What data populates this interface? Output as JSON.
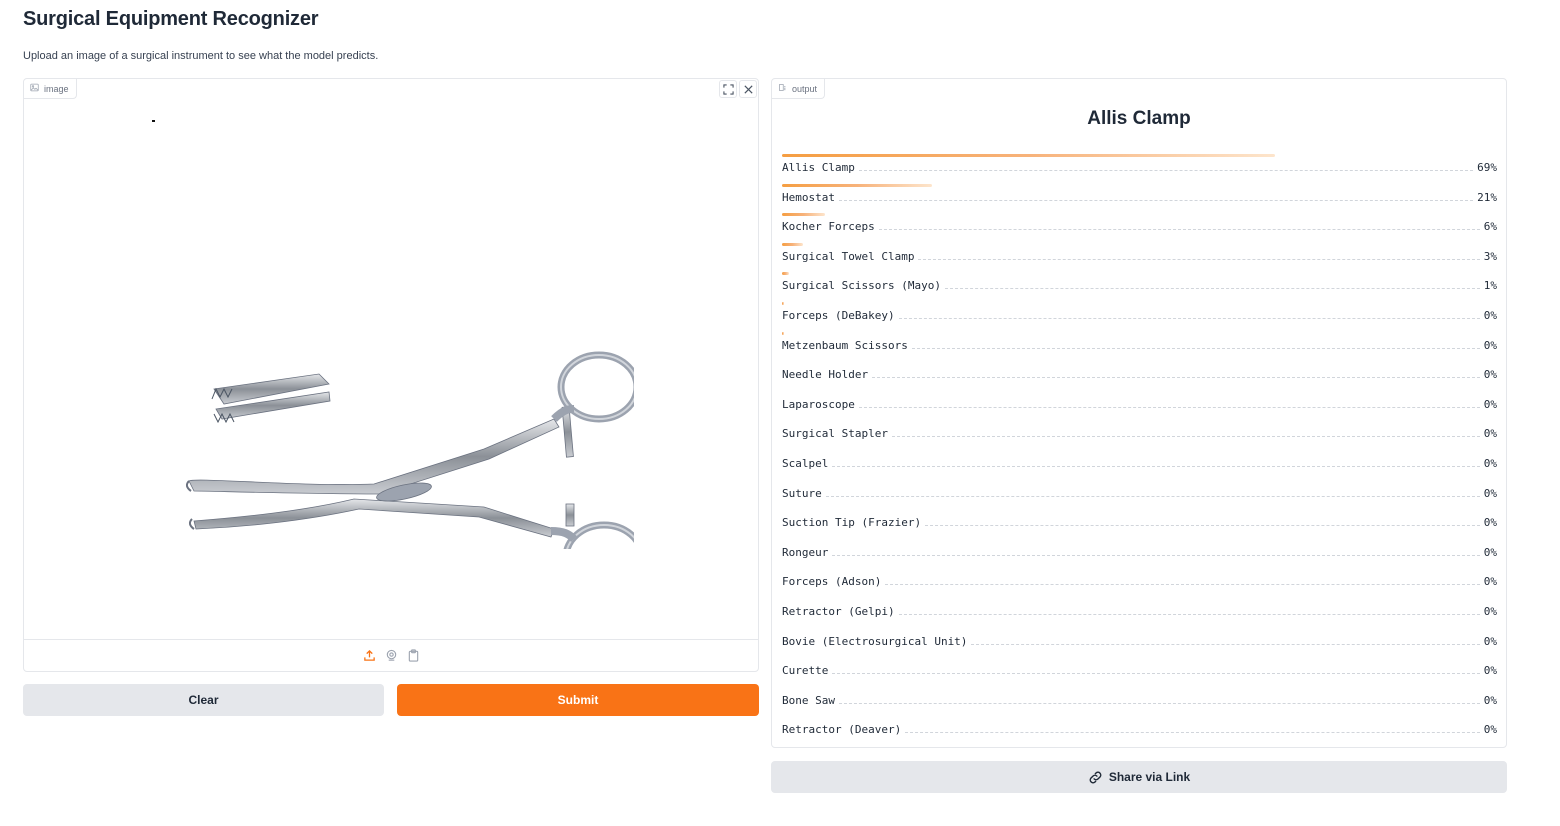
{
  "header": {
    "title": "Surgical Equipment Recognizer",
    "description": "Upload an image of a surgical instrument to see what the model predicts."
  },
  "image_input": {
    "label": "image",
    "icons": [
      "image-icon",
      "fullscreen-icon",
      "close-icon",
      "upload-icon",
      "webcam-icon",
      "clipboard-icon"
    ]
  },
  "buttons": {
    "clear": "Clear",
    "submit": "Submit",
    "share": "Share via Link"
  },
  "output": {
    "label": "output",
    "top_prediction": "Allis Clamp",
    "confidences": [
      {
        "label": "Allis Clamp",
        "value_text": "69%",
        "fraction": 0.69
      },
      {
        "label": "Hemostat",
        "value_text": "21%",
        "fraction": 0.21
      },
      {
        "label": "Kocher Forceps",
        "value_text": "6%",
        "fraction": 0.06
      },
      {
        "label": "Surgical Towel Clamp",
        "value_text": "3%",
        "fraction": 0.03
      },
      {
        "label": "Surgical Scissors (Mayo)",
        "value_text": "1%",
        "fraction": 0.01
      },
      {
        "label": "Forceps (DeBakey)",
        "value_text": "0%",
        "fraction": 0.003
      },
      {
        "label": "Metzenbaum Scissors",
        "value_text": "0%",
        "fraction": 0.002
      },
      {
        "label": "Needle Holder",
        "value_text": "0%",
        "fraction": 0.0
      },
      {
        "label": "Laparoscope",
        "value_text": "0%",
        "fraction": 0.0
      },
      {
        "label": "Surgical Stapler",
        "value_text": "0%",
        "fraction": 0.0
      },
      {
        "label": "Scalpel",
        "value_text": "0%",
        "fraction": 0.0
      },
      {
        "label": "Suture",
        "value_text": "0%",
        "fraction": 0.0
      },
      {
        "label": "Suction Tip (Frazier)",
        "value_text": "0%",
        "fraction": 0.0
      },
      {
        "label": "Rongeur",
        "value_text": "0%",
        "fraction": 0.0
      },
      {
        "label": "Forceps (Adson)",
        "value_text": "0%",
        "fraction": 0.0
      },
      {
        "label": "Retractor (Gelpi)",
        "value_text": "0%",
        "fraction": 0.0
      },
      {
        "label": "Bovie (Electrosurgical Unit)",
        "value_text": "0%",
        "fraction": 0.0
      },
      {
        "label": "Curette",
        "value_text": "0%",
        "fraction": 0.0
      },
      {
        "label": "Bone Saw",
        "value_text": "0%",
        "fraction": 0.0
      },
      {
        "label": "Retractor (Deaver)",
        "value_text": "0%",
        "fraction": 0.0
      }
    ]
  },
  "colors": {
    "accent": "#f97316",
    "bar": "#f59e42",
    "button_gray": "#e5e7eb"
  }
}
